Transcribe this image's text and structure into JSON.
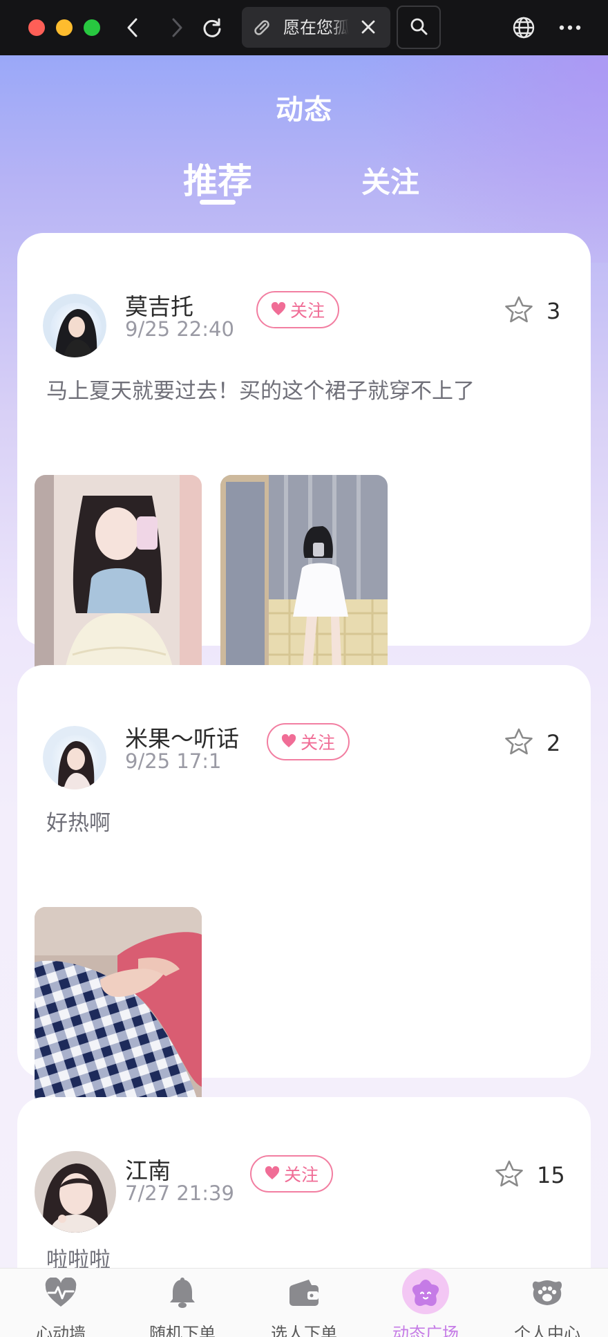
{
  "browser": {
    "tab_title": "愿在您孤独时陪伴您",
    "icons": [
      "back-icon",
      "forward-icon",
      "reload-icon",
      "link-icon",
      "close-icon",
      "search-icon",
      "globe-icon",
      "more-icon"
    ]
  },
  "header": {
    "title": "动态",
    "tabs": [
      {
        "label": "推荐",
        "active": true
      },
      {
        "label": "关注",
        "active": false
      }
    ]
  },
  "posts": [
    {
      "username": "莫吉托",
      "time": "9/25 22:40",
      "follow_label": "关注",
      "likes": "3",
      "text": "马上夏天就要过去！买的这个裙子就穿不上了",
      "photo_count": 2
    },
    {
      "username": "米果～听话",
      "time": "9/25 17:1",
      "follow_label": "关注",
      "likes": "2",
      "text": "好热啊",
      "photo_count": 1
    },
    {
      "username": "江南",
      "time": "7/27 21:39",
      "follow_label": "关注",
      "likes": "15",
      "text": "啦啦啦",
      "photo_count": 0
    }
  ],
  "tabbar": {
    "items": [
      {
        "label": "心动墙",
        "icon": "heartbeat-icon",
        "active": false
      },
      {
        "label": "随机下单",
        "icon": "bell-icon",
        "active": false
      },
      {
        "label": "选人下单",
        "icon": "wallet-icon",
        "active": false
      },
      {
        "label": "动态广场",
        "icon": "flower-icon",
        "active": true
      },
      {
        "label": "个人中心",
        "icon": "paw-icon",
        "active": false
      }
    ]
  },
  "colors": {
    "accent_pink": "#f06d96",
    "active_purple": "#c57be6",
    "header_gradient_start": "#9aa8f8"
  }
}
